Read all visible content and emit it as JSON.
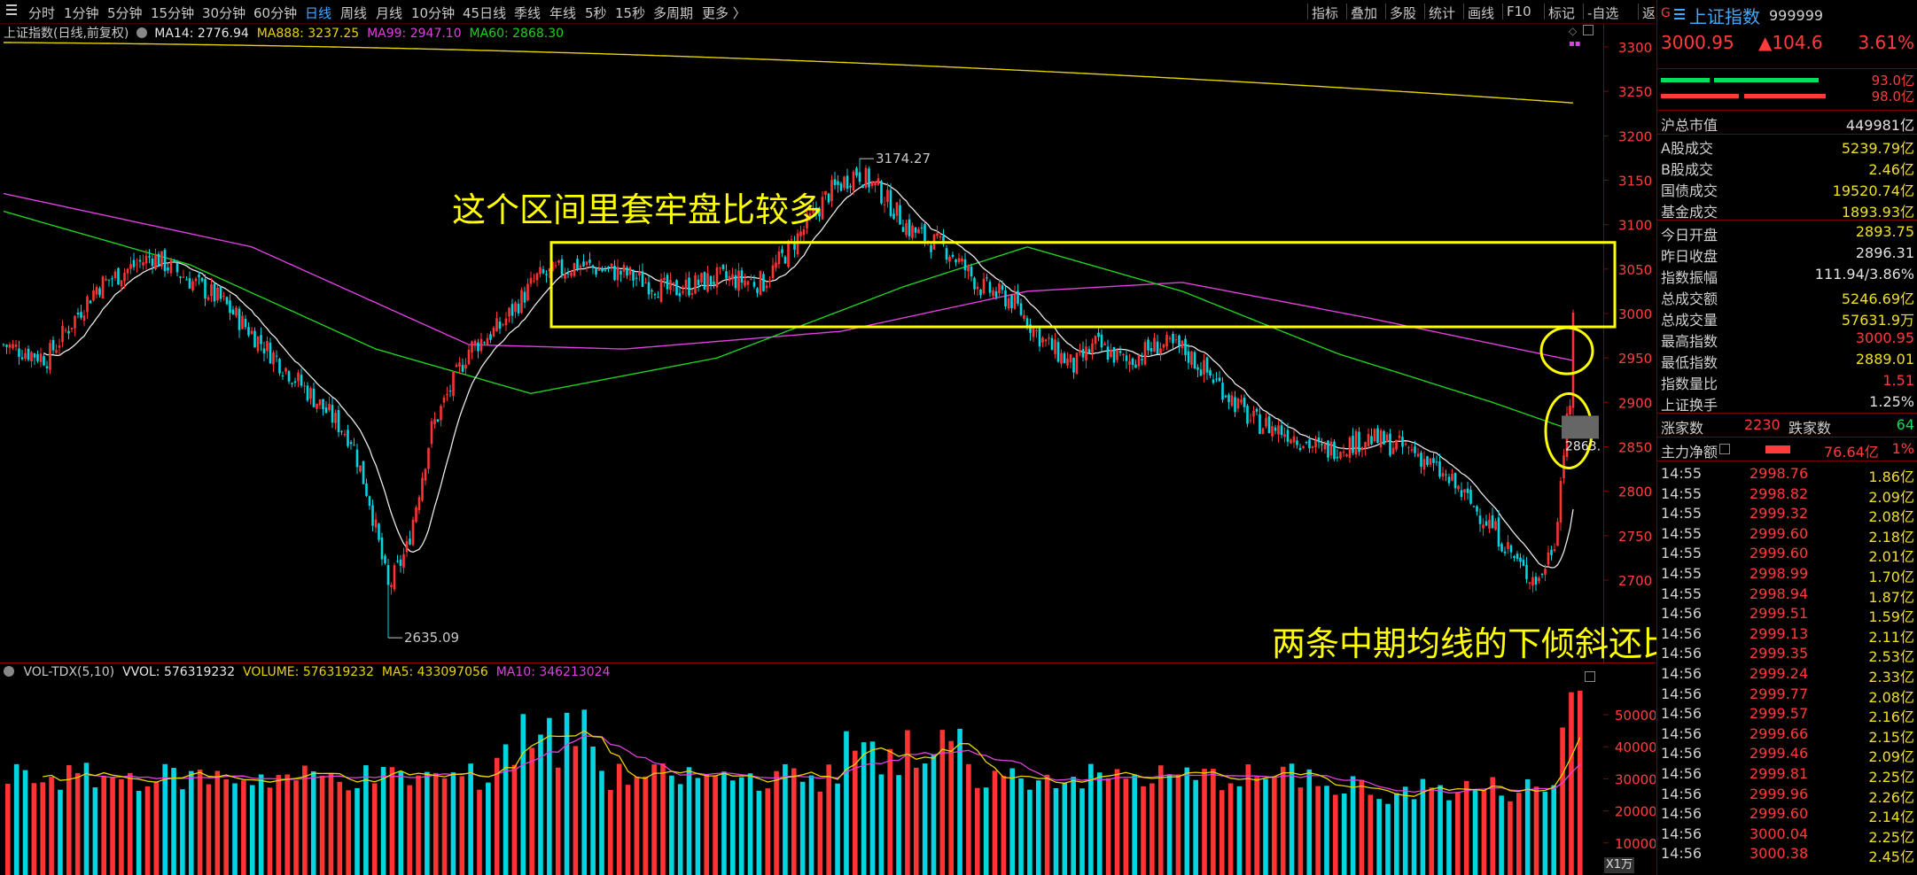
{
  "toolbar": {
    "periods": [
      "分时",
      "1分钟",
      "5分钟",
      "15分钟",
      "30分钟",
      "60分钟",
      "日线",
      "周线",
      "月线",
      "10分钟",
      "45日线",
      "季线",
      "年线",
      "5秒",
      "15秒",
      "多周期",
      "更多 〉"
    ],
    "active_period": "日线",
    "right_tools": [
      "指标",
      "叠加",
      "多股",
      "统计",
      "画线",
      "F10",
      "标记",
      "-自选",
      "返回"
    ]
  },
  "main_legend": {
    "instrument": "上证指数(日线,前复权)",
    "ma": [
      {
        "text": "MA14: 2776.94",
        "color": "#e8e8e8"
      },
      {
        "text": "MA888: 3237.25",
        "color": "#e8d400"
      },
      {
        "text": "MA99: 2947.10",
        "color": "#e040e0"
      },
      {
        "text": "MA60: 2868.30",
        "color": "#20d020"
      }
    ]
  },
  "annotations": {
    "top_text": "这个区间里套牢盘比较多",
    "bottom_text": "两条中期均线的下倾斜还比较明显",
    "high_label": "3174.27",
    "low_label": "2635.09",
    "cursor_label": "2863."
  },
  "colors": {
    "up": "#ff3333",
    "down": "#00d5e0",
    "ma14": "#e8e8e8",
    "ma888": "#e8d400",
    "ma99": "#e040e0",
    "ma60": "#20d020",
    "annotation": "#ffff00",
    "accent": "#3fa9ff"
  },
  "price_axis": [
    "3300",
    "3250",
    "3200",
    "3150",
    "3100",
    "3050",
    "3000",
    "2950",
    "2900",
    "2850",
    "2800",
    "2750",
    "2700"
  ],
  "volume_legend": {
    "name": "VOL-TDX(5,10)",
    "items": [
      {
        "text": "VVOL: 576319232",
        "color": "#e8e8e8"
      },
      {
        "text": "VOLUME: 576319232",
        "color": "#e8d400"
      },
      {
        "text": "MA5: 433097056",
        "color": "#e8d400"
      },
      {
        "text": "MA10: 346213024",
        "color": "#e040e0"
      }
    ]
  },
  "volume_axis": [
    "50000",
    "40000",
    "30000",
    "20000",
    "10000"
  ],
  "volume_unit": "X1万",
  "chart_data": {
    "type": "candlestick",
    "instrument": "上证指数",
    "price_ylim": [
      2630,
      3320
    ],
    "extremes": {
      "high": 3174.27,
      "low": 2635.09
    },
    "last_close": 3000.95,
    "moving_averages": {
      "MA14": 2776.94,
      "MA888": 3237.25,
      "MA99": 2947.1,
      "MA60": 2868.3
    },
    "highlight_zone": {
      "from": 2985,
      "to": 3080
    },
    "volume_ylim": [
      0,
      58000
    ],
    "volume_last": {
      "VOLUME": 576319232,
      "MA5": 433097056,
      "MA10": 346213024
    }
  },
  "right_panel": {
    "code_badge": "G",
    "menu_icon": "menu-icon",
    "name": "上证指数",
    "code": "999999",
    "price": "3000.95",
    "change": "▲104.6",
    "change_pct": "3.61%",
    "bar1_value": "93.0亿",
    "bar2_value": "98.0亿",
    "market_value_label": "沪总市值",
    "market_value": "449981亿",
    "stats1": [
      {
        "label": "A股成交",
        "value": "5239.79亿",
        "color": "yel"
      },
      {
        "label": "B股成交",
        "value": "2.46亿",
        "color": "yel"
      },
      {
        "label": "国债成交",
        "value": "19520.74亿",
        "color": "yel"
      },
      {
        "label": "基金成交",
        "value": "1893.93亿",
        "color": "yel"
      }
    ],
    "stats2": [
      {
        "label": "今日开盘",
        "value": "2893.75",
        "color": "yel"
      },
      {
        "label": "昨日收盘",
        "value": "2896.31",
        "color": "wht"
      },
      {
        "label": "指数振幅",
        "value": "111.94/3.86%",
        "color": "wht"
      },
      {
        "label": "总成交额",
        "value": "5246.69亿",
        "color": "yel"
      },
      {
        "label": "总成交量",
        "value": "57631.9万",
        "color": "yel"
      },
      {
        "label": "最高指数",
        "value": "3000.95",
        "color": "red"
      },
      {
        "label": "最低指数",
        "value": "2889.01",
        "color": "yel"
      },
      {
        "label": "指数量比",
        "value": "1.51",
        "color": "red"
      },
      {
        "label": "上证换手",
        "value": "1.25%",
        "color": "wht"
      }
    ],
    "advance_label": "涨家数",
    "advance_value": "2230",
    "decline_label": "跌家数",
    "decline_value": "64",
    "capital_label": "主力净额",
    "capital_value": "76.64亿",
    "capital_pct": "1%",
    "ticks": [
      {
        "time": "14:55",
        "price": "2998.76",
        "pct": "1.86亿"
      },
      {
        "time": "14:55",
        "price": "2998.82",
        "pct": "2.09亿"
      },
      {
        "time": "14:55",
        "price": "2999.32",
        "pct": "2.08亿"
      },
      {
        "time": "14:55",
        "price": "2999.60",
        "pct": "2.18亿"
      },
      {
        "time": "14:55",
        "price": "2999.60",
        "pct": "2.01亿"
      },
      {
        "time": "14:55",
        "price": "2998.99",
        "pct": "1.70亿"
      },
      {
        "time": "14:55",
        "price": "2998.94",
        "pct": "1.87亿"
      },
      {
        "time": "14:56",
        "price": "2999.51",
        "pct": "1.59亿"
      },
      {
        "time": "14:56",
        "price": "2999.13",
        "pct": "2.11亿"
      },
      {
        "time": "14:56",
        "price": "2999.35",
        "pct": "2.53亿"
      },
      {
        "time": "14:56",
        "price": "2999.24",
        "pct": "2.33亿"
      },
      {
        "time": "14:56",
        "price": "2999.77",
        "pct": "2.08亿"
      },
      {
        "time": "14:56",
        "price": "2999.57",
        "pct": "2.16亿"
      },
      {
        "time": "14:56",
        "price": "2999.66",
        "pct": "2.15亿"
      },
      {
        "time": "14:56",
        "price": "2999.46",
        "pct": "2.09亿"
      },
      {
        "time": "14:56",
        "price": "2999.81",
        "pct": "2.25亿"
      },
      {
        "time": "14:56",
        "price": "2999.96",
        "pct": "2.26亿"
      },
      {
        "time": "14:56",
        "price": "2999.60",
        "pct": "2.14亿"
      },
      {
        "time": "14:56",
        "price": "3000.04",
        "pct": "2.25亿"
      },
      {
        "time": "14:56",
        "price": "3000.38",
        "pct": "2.45亿"
      }
    ]
  }
}
